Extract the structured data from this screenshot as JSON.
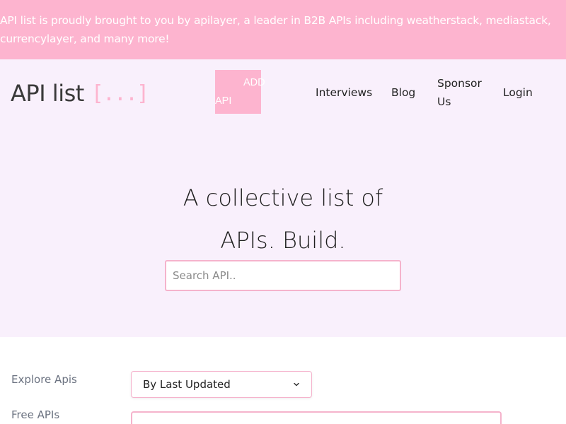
{
  "banner": {
    "line1": "API list is proudly brought to you by apilayer, a leader in B2B APIs including weatherstack, mediastack,",
    "line2": "currencylayer, and many more!"
  },
  "logo": {
    "text": "API list",
    "brackets": "[...]"
  },
  "add_api": {
    "line1": "ADD",
    "line2": "API"
  },
  "nav": {
    "interviews": "Interviews",
    "blog": "Blog",
    "sponsor_line1": "Sponsor",
    "sponsor_line2": "Us",
    "login": "Login"
  },
  "hero": {
    "line1": "A collective list of",
    "line2": "APIs. Build."
  },
  "search": {
    "placeholder": "Search API.."
  },
  "filters": {
    "explore_label": "Explore Apis",
    "free_label": "Free APIs",
    "sort_selected": "By Last Updated"
  },
  "colors": {
    "accent": "#fdb4cf",
    "header_bg": "#f9f0fc"
  },
  "icons": {
    "select": "chevron-down-icon"
  }
}
